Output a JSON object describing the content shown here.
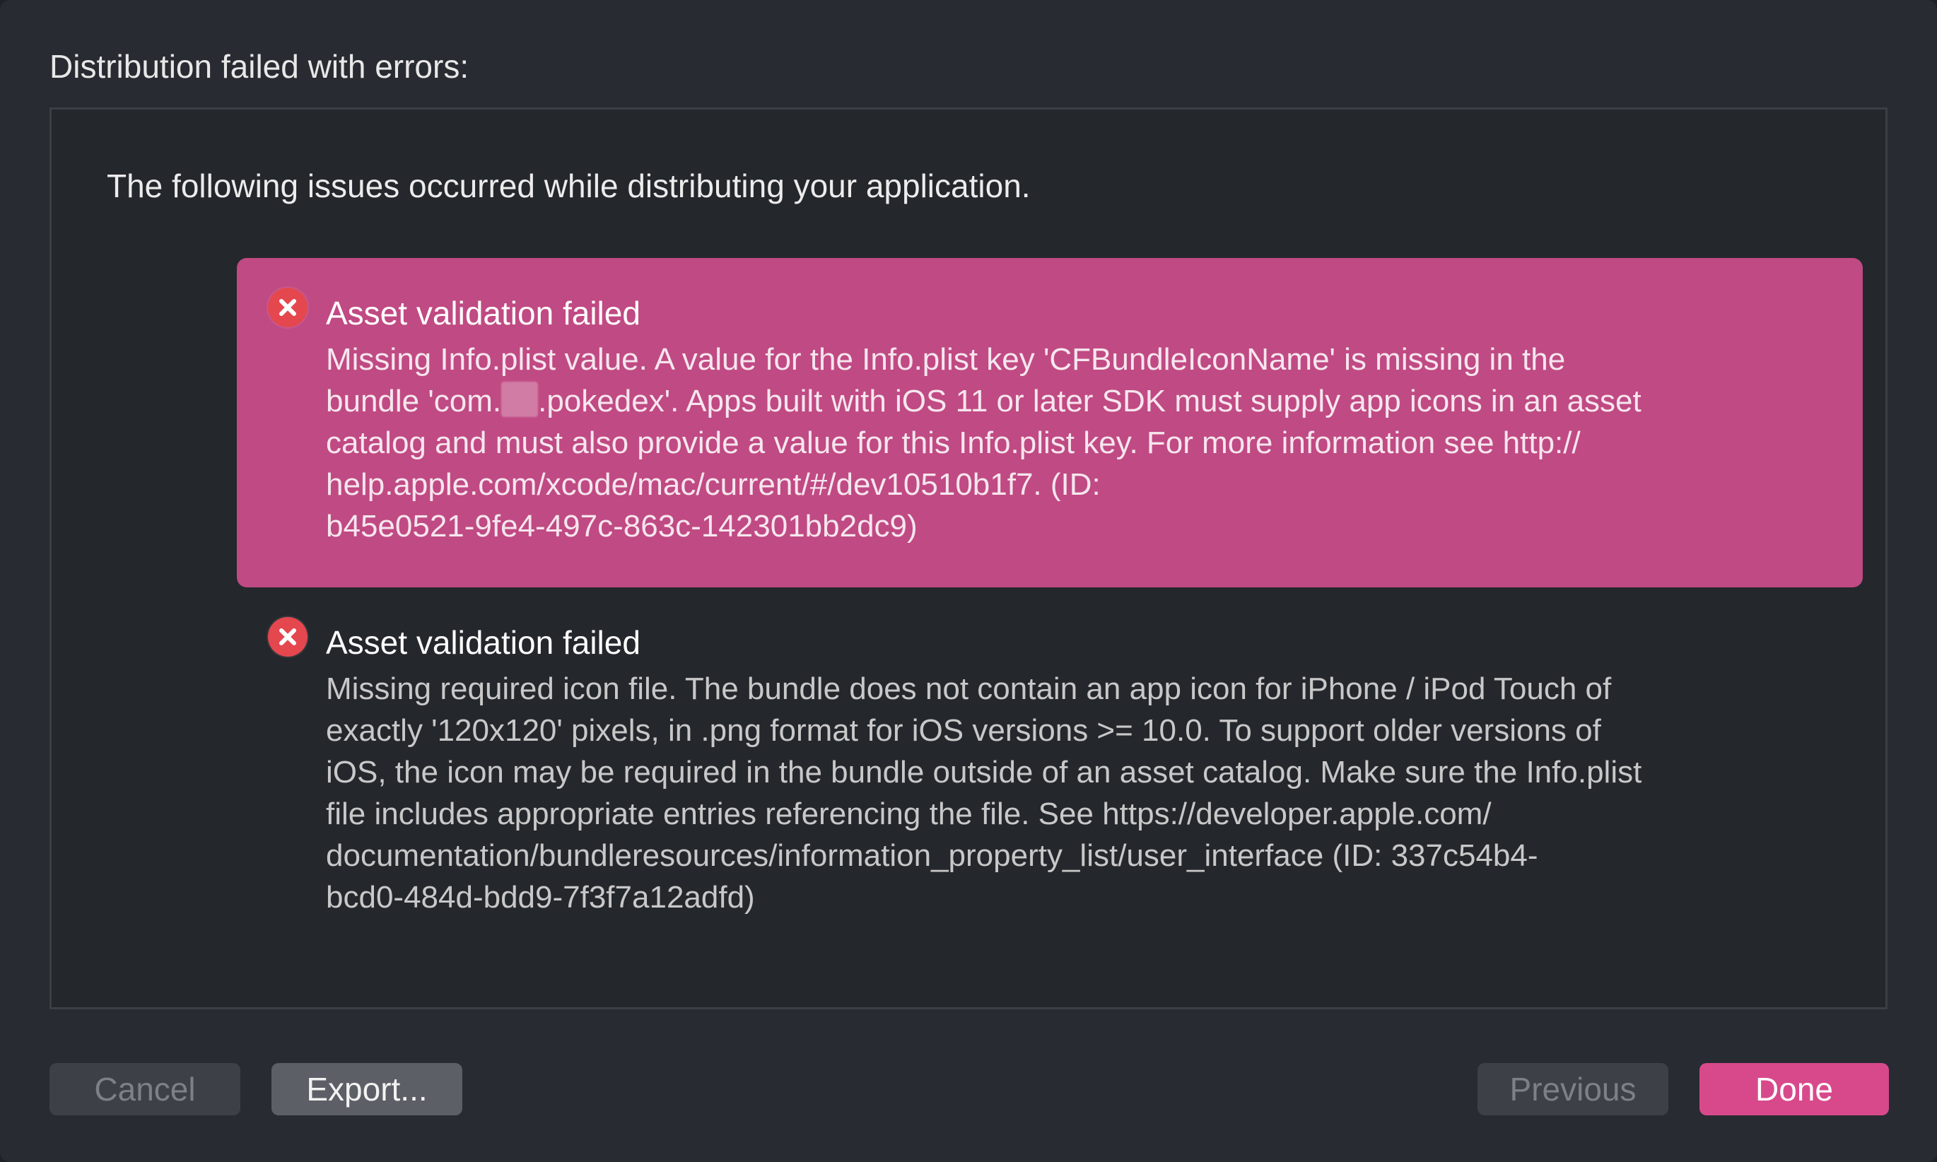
{
  "dialog": {
    "heading": "Distribution failed with errors:",
    "intro": "The following issues occurred while distributing your application."
  },
  "issues": [
    {
      "icon": "error-icon",
      "title": "Asset validation failed",
      "lines": {
        "l0": "Missing Info.plist value. A value for the Info.plist key 'CFBundleIconName' is missing in the",
        "l1a": "bundle 'com.",
        "l1b": ".pokedex'. Apps built with iOS 11 or later SDK must supply app icons in an asset",
        "l2": "catalog and must also provide a value for this Info.plist key. For more information see http://",
        "l3": "help.apple.com/xcode/mac/current/#/dev10510b1f7. (ID:",
        "l4": "b45e0521-9fe4-497c-863c-142301bb2dc9)"
      }
    },
    {
      "icon": "error-icon",
      "title": "Asset validation failed",
      "lines": {
        "l0": "Missing required icon file. The bundle does not contain an app icon for iPhone / iPod Touch of",
        "l1": "exactly '120x120' pixels, in .png format for iOS versions >= 10.0. To support older versions of",
        "l2": "iOS, the icon may be required in the bundle outside of an asset catalog. Make sure the Info.plist",
        "l3": "file includes appropriate entries referencing the file. See https://developer.apple.com/",
        "l4": "documentation/bundleresources/information_property_list/user_interface (ID: 337c54b4-",
        "l5": "bcd0-484d-bdd9-7f3f7a12adfd)"
      }
    }
  ],
  "buttons": {
    "cancel": "Cancel",
    "export": "Export...",
    "previous": "Previous",
    "done": "Done"
  },
  "colors": {
    "accent": "#d8498c",
    "selected_row": "#c04a83",
    "error": "#e5474f",
    "background": "#282b31"
  }
}
